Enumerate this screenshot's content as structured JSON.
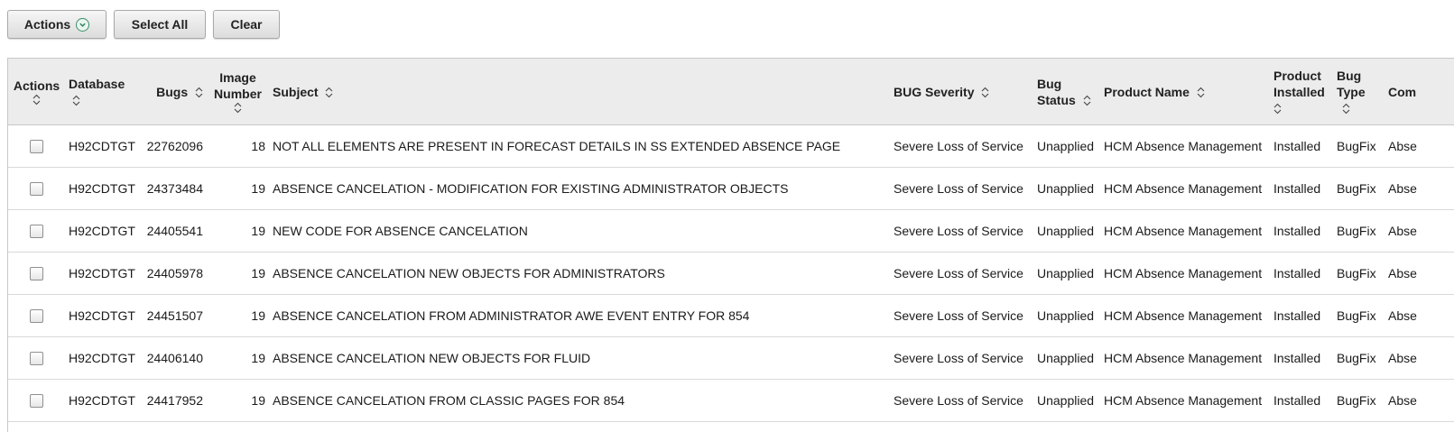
{
  "toolbar": {
    "actions_label": "Actions",
    "select_all_label": "Select All",
    "clear_label": "Clear"
  },
  "table": {
    "headers": {
      "actions": "Actions",
      "database": "Database",
      "bugs": "Bugs",
      "image_number_line1": "Image",
      "image_number_line2": "Number",
      "subject": "Subject",
      "bug_severity": "BUG Severity",
      "bug_status_line1": "Bug",
      "bug_status_line2": "Status",
      "product_name": "Product Name",
      "product_installed_line1": "Product",
      "product_installed_line2": "Installed",
      "bug_type_line1": "Bug",
      "bug_type_line2": "Type",
      "component": "Com"
    },
    "rows": [
      {
        "database": "H92CDTGT",
        "bug": "22762096",
        "image": "18",
        "subject": "NOT ALL ELEMENTS ARE PRESENT IN FORECAST DETAILS IN SS EXTENDED ABSENCE PAGE",
        "severity": "Severe Loss of Service",
        "status": "Unapplied",
        "product": "HCM Absence Management",
        "installed": "Installed",
        "type": "BugFix",
        "component": "Abse"
      },
      {
        "database": "H92CDTGT",
        "bug": "24373484",
        "image": "19",
        "subject": "ABSENCE CANCELATION - MODIFICATION FOR EXISTING ADMINISTRATOR OBJECTS",
        "severity": "Severe Loss of Service",
        "status": "Unapplied",
        "product": "HCM Absence Management",
        "installed": "Installed",
        "type": "BugFix",
        "component": "Abse"
      },
      {
        "database": "H92CDTGT",
        "bug": "24405541",
        "image": "19",
        "subject": "NEW CODE FOR ABSENCE CANCELATION",
        "severity": "Severe Loss of Service",
        "status": "Unapplied",
        "product": "HCM Absence Management",
        "installed": "Installed",
        "type": "BugFix",
        "component": "Abse"
      },
      {
        "database": "H92CDTGT",
        "bug": "24405978",
        "image": "19",
        "subject": "ABSENCE CANCELATION NEW OBJECTS FOR ADMINISTRATORS",
        "severity": "Severe Loss of Service",
        "status": "Unapplied",
        "product": "HCM Absence Management",
        "installed": "Installed",
        "type": "BugFix",
        "component": "Abse"
      },
      {
        "database": "H92CDTGT",
        "bug": "24451507",
        "image": "19",
        "subject": "ABSENCE CANCELATION FROM ADMINISTRATOR AWE EVENT ENTRY FOR 854",
        "severity": "Severe Loss of Service",
        "status": "Unapplied",
        "product": "HCM Absence Management",
        "installed": "Installed",
        "type": "BugFix",
        "component": "Abse"
      },
      {
        "database": "H92CDTGT",
        "bug": "24406140",
        "image": "19",
        "subject": "ABSENCE CANCELATION NEW OBJECTS FOR FLUID",
        "severity": "Severe Loss of Service",
        "status": "Unapplied",
        "product": "HCM Absence Management",
        "installed": "Installed",
        "type": "BugFix",
        "component": "Abse"
      },
      {
        "database": "H92CDTGT",
        "bug": "24417952",
        "image": "19",
        "subject": "ABSENCE CANCELATION FROM CLASSIC PAGES FOR 854",
        "severity": "Severe Loss of Service",
        "status": "Unapplied",
        "product": "HCM Absence Management",
        "installed": "Installed",
        "type": "BugFix",
        "component": "Abse"
      }
    ]
  }
}
